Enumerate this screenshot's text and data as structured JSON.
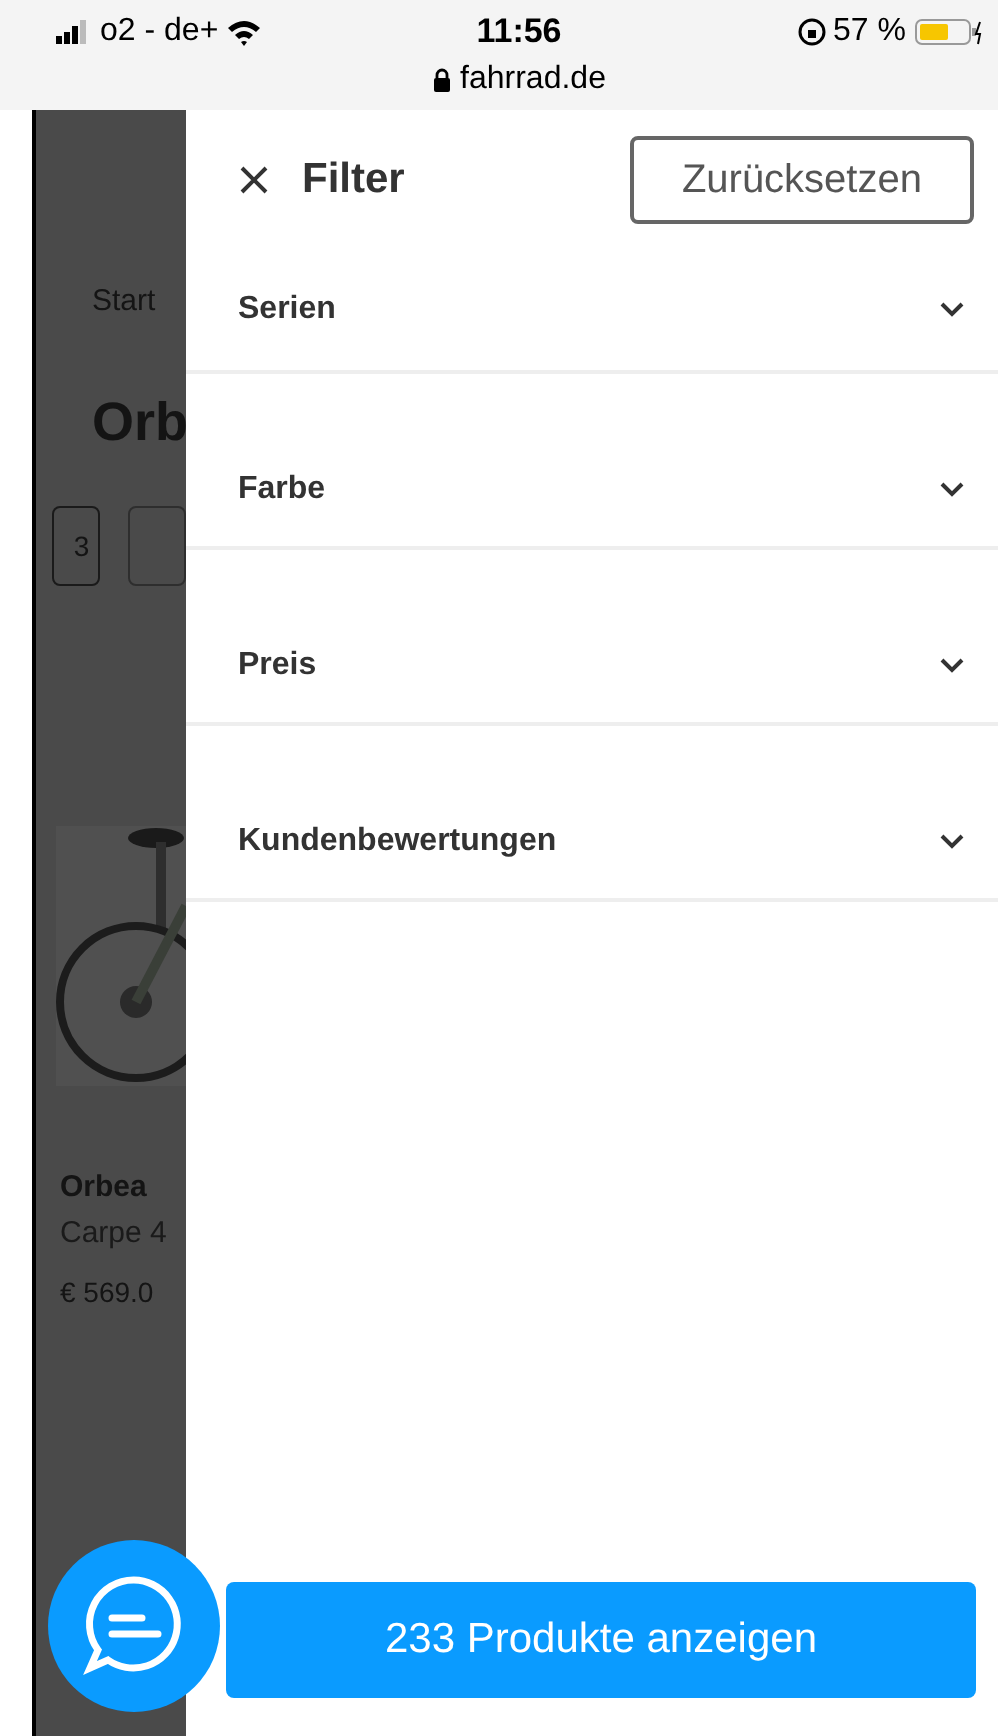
{
  "status_bar": {
    "carrier": "o2 - de+",
    "time": "11:56",
    "url": "fahrrad.de",
    "battery": "57 %"
  },
  "background_page": {
    "breadcrumb": "Start",
    "heading": "Orb",
    "chip": "3",
    "product_brand": "Orbea",
    "product_name": "Carpe 4",
    "product_price": "€ 569.0"
  },
  "filter_panel": {
    "title": "Filter",
    "reset_button": "Zurücksetzen",
    "sections": [
      {
        "label": "Serien",
        "expanded": false
      },
      {
        "label": "Farbe",
        "expanded": false
      },
      {
        "label": "Preis",
        "expanded": false
      },
      {
        "label": "Kundenbewertungen",
        "expanded": false
      }
    ],
    "apply_button": "233 Produkte anzeigen"
  }
}
